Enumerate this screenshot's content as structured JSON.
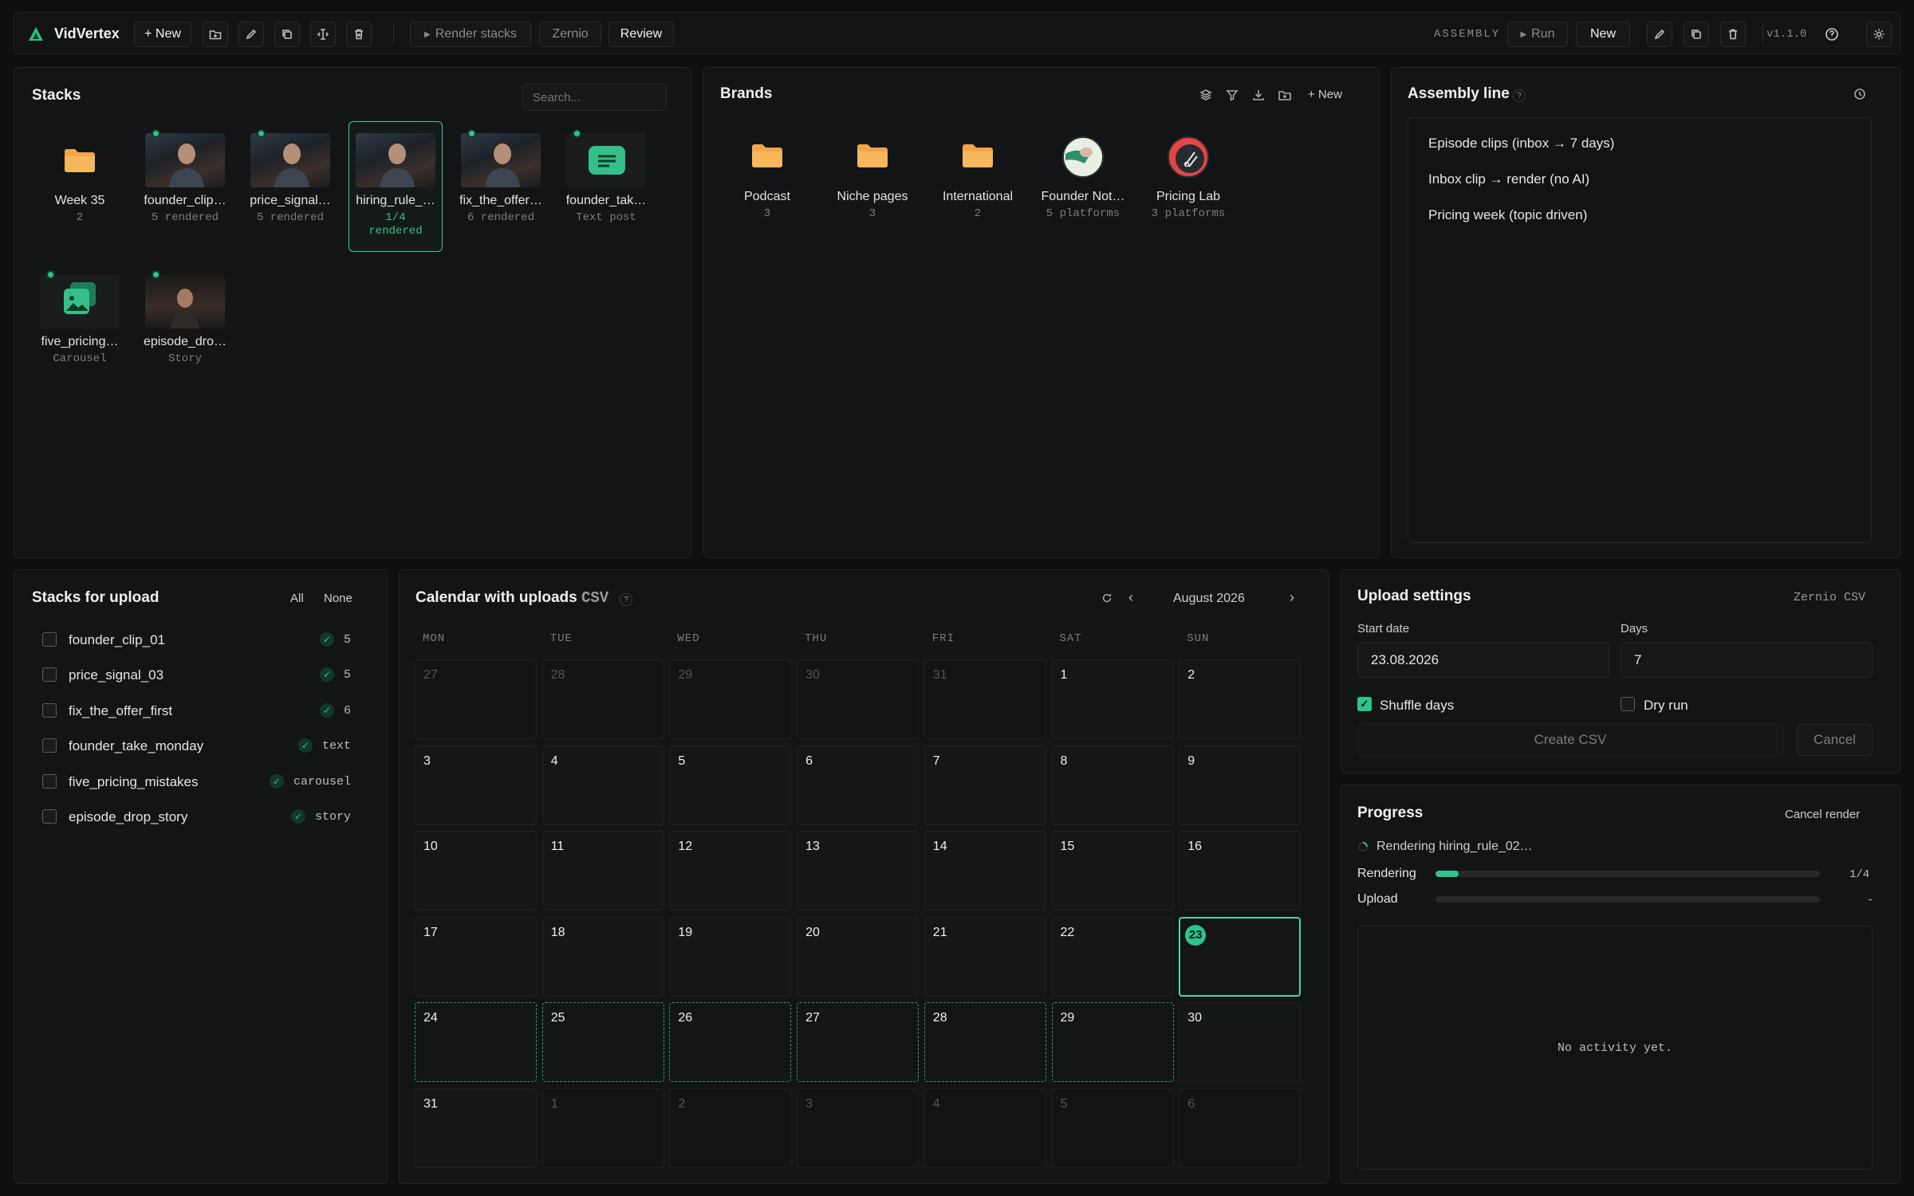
{
  "app": {
    "name": "VidVertex",
    "version": "v1.1.0"
  },
  "topbar": {
    "new_label": "+ New",
    "render_stacks_label": "Render stacks",
    "zernio_label": "Zernio",
    "review_label": "Review",
    "assembly_label": "ASSEMBLY",
    "run_label": "Run",
    "new2_label": "New"
  },
  "stacks": {
    "title": "Stacks",
    "search_placeholder": "Search...",
    "items": [
      {
        "name": "Week 35",
        "sub": "2",
        "kind": "folder",
        "status": false,
        "selected": false
      },
      {
        "name": "founder_clip…",
        "sub": "5 rendered",
        "kind": "photo",
        "status": true,
        "selected": false
      },
      {
        "name": "price_signal…",
        "sub": "5 rendered",
        "kind": "photo",
        "status": true,
        "selected": false
      },
      {
        "name": "hiring_rule_…",
        "sub": "1/4",
        "sub2": "rendered",
        "kind": "photo",
        "status": false,
        "selected": true
      },
      {
        "name": "fix_the_offer…",
        "sub": "6 rendered",
        "kind": "photo",
        "status": true,
        "selected": false
      },
      {
        "name": "founder_tak…",
        "sub": "Text post",
        "kind": "text",
        "status": true,
        "selected": false
      },
      {
        "name": "five_pricing…",
        "sub": "Carousel",
        "kind": "carousel",
        "status": true,
        "selected": false
      },
      {
        "name": "episode_dro…",
        "sub": "Story",
        "kind": "story",
        "status": true,
        "selected": false
      }
    ]
  },
  "brands": {
    "title": "Brands",
    "new_label": "+ New",
    "items": [
      {
        "name": "Podcast",
        "sub": "3",
        "kind": "folder"
      },
      {
        "name": "Niche pages",
        "sub": "3",
        "kind": "folder"
      },
      {
        "name": "International",
        "sub": "2",
        "kind": "folder"
      },
      {
        "name": "Founder Not…",
        "sub": "5 platforms",
        "kind": "avatar-green"
      },
      {
        "name": "Pricing Lab",
        "sub": "3 platforms",
        "kind": "avatar-red"
      }
    ]
  },
  "assembly": {
    "title": "Assembly line",
    "help": "?",
    "items": [
      "Episode clips (inbox → 7 days)",
      "Inbox clip → render (no AI)",
      "Pricing week (topic driven)"
    ]
  },
  "upload_stacks": {
    "title": "Stacks for upload",
    "all_label": "All",
    "none_label": "None",
    "items": [
      {
        "name": "founder_clip_01",
        "count": "5"
      },
      {
        "name": "price_signal_03",
        "count": "5"
      },
      {
        "name": "fix_the_offer_first",
        "count": "6"
      },
      {
        "name": "founder_take_monday",
        "count": "text"
      },
      {
        "name": "five_pricing_mistakes",
        "count": "carousel"
      },
      {
        "name": "episode_drop_story",
        "count": "story"
      }
    ]
  },
  "calendar": {
    "title": "Calendar with uploads",
    "csv_tag": "CSV",
    "help": "?",
    "month": "August 2026",
    "weekdays": [
      "MON",
      "TUE",
      "WED",
      "THU",
      "FRI",
      "SAT",
      "SUN"
    ],
    "today": "23",
    "weeks": [
      [
        "27",
        "28",
        "29",
        "30",
        "31",
        "1",
        "2"
      ],
      [
        "3",
        "4",
        "5",
        "6",
        "7",
        "8",
        "9"
      ],
      [
        "10",
        "11",
        "12",
        "13",
        "14",
        "15",
        "16"
      ],
      [
        "17",
        "18",
        "19",
        "20",
        "21",
        "22",
        "23"
      ],
      [
        "24",
        "25",
        "26",
        "27",
        "28",
        "29",
        "30"
      ],
      [
        "31",
        "1",
        "2",
        "3",
        "4",
        "5",
        "6"
      ]
    ]
  },
  "upload_settings": {
    "title": "Upload settings",
    "target": "Zernio CSV",
    "start_date_label": "Start date",
    "start_date_value": "23.08.2026",
    "days_label": "Days",
    "days_value": "7",
    "shuffle_label": "Shuffle days",
    "shuffle_checked": true,
    "dry_run_label": "Dry run",
    "dry_run_checked": false,
    "create_label": "Create CSV",
    "cancel_label": "Cancel"
  },
  "progress": {
    "title": "Progress",
    "cancel_label": "Cancel render",
    "status": "Rendering hiring_rule_02…",
    "rendering_label": "Rendering",
    "rendering_value": "1/4",
    "rendering_fraction": 0.06,
    "upload_label": "Upload",
    "upload_value": "-",
    "empty_text": "No activity yet."
  },
  "colors": {
    "accent": "#35c08a",
    "folder": "#f2a64a",
    "background": "#0e0f10"
  }
}
